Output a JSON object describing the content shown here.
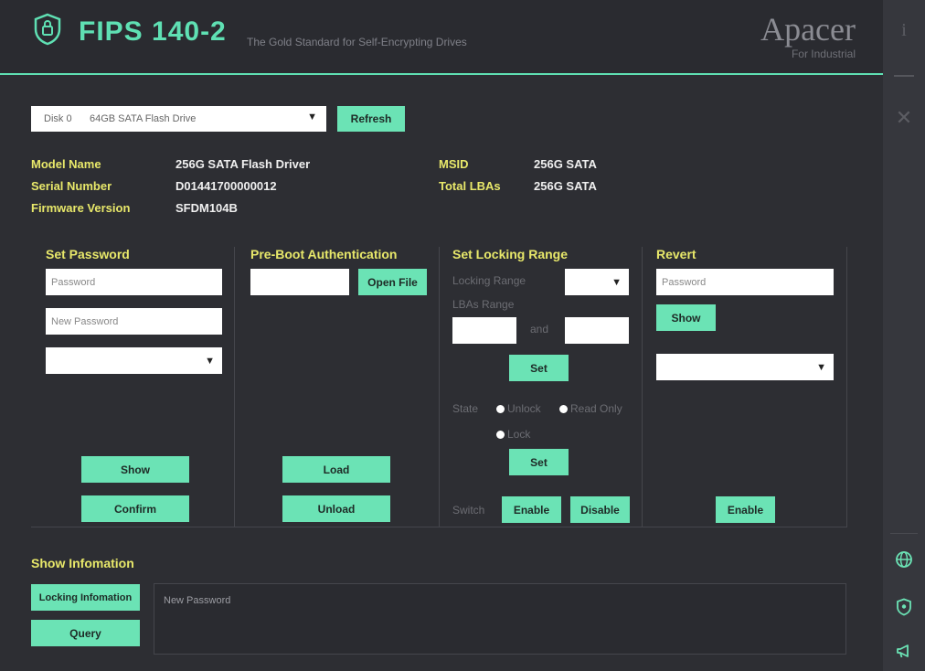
{
  "header": {
    "title": "FIPS 140-2",
    "subtitle": "The Gold Standard for Self-Encrypting Drives",
    "brand": "Apacer",
    "brand_sub": "For Industrial"
  },
  "sidebar": {
    "info": "i",
    "close": "✕",
    "icons": [
      "globe-icon",
      "shield-icon",
      "megaphone-icon"
    ]
  },
  "disk": {
    "disk_label": "Disk 0",
    "disk_desc": "64GB SATA Flash Drive",
    "refresh": "Refresh"
  },
  "info": {
    "model_label": "Model Name",
    "model_value": "256G SATA Flash Driver",
    "serial_label": "Serial Number",
    "serial_value": "D01441700000012",
    "firmware_label": "Firmware Version",
    "firmware_value": "SFDM104B",
    "msid_label": "MSID",
    "msid_value": "256G SATA",
    "lba_label": "Total LBAs",
    "lba_value": "256G SATA"
  },
  "set_password": {
    "title": "Set Password",
    "password_placeholder": "Password",
    "new_password_placeholder": "New Password",
    "show": "Show",
    "confirm": "Confirm"
  },
  "preboot": {
    "title": "Pre-Boot Authentication",
    "open_file": "Open File",
    "load": "Load",
    "unload": "Unload"
  },
  "locking": {
    "title": "Set Locking Range",
    "locking_range": "Locking Range",
    "lbas_range": "LBAs Range",
    "and": "and",
    "set": "Set",
    "state": "State",
    "unlock": "Unlock",
    "read_only": "Read Only",
    "lock": "Lock",
    "set2": "Set",
    "switch": "Switch",
    "enable": "Enable",
    "disable": "Disable"
  },
  "revert": {
    "title": "Revert",
    "password_placeholder": "Password",
    "show": "Show",
    "enable": "Enable"
  },
  "show_info": {
    "title": "Show Infomation",
    "locking_info": "Locking Infomation",
    "query": "Query",
    "box_text": "New Password"
  },
  "colors": {
    "accent": "#6be3b5",
    "label": "#e8e86a",
    "background": "#2d2e33"
  }
}
